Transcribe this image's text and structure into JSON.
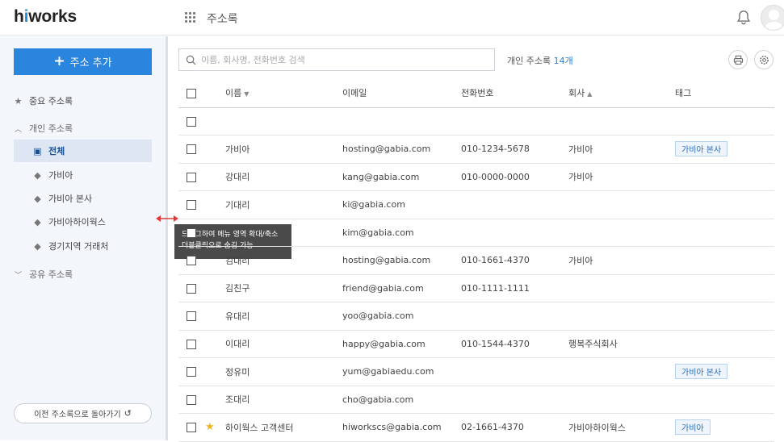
{
  "header": {
    "logo_prefix": "h",
    "logo_i": "i",
    "logo_rest": "works",
    "app_title": "주소록"
  },
  "sidebar": {
    "add_label": "주소 추가",
    "items": [
      {
        "label": "중요 주소록",
        "icon": "star-icon"
      },
      {
        "label": "개인 주소록",
        "icon": "chevron-up-icon"
      },
      {
        "label": "전체",
        "icon": "contact-card-icon",
        "selected": true
      },
      {
        "label": "가비아",
        "icon": "tag-icon"
      },
      {
        "label": "가비아 본사",
        "icon": "tag-icon"
      },
      {
        "label": "가비아하이웍스",
        "icon": "tag-icon"
      },
      {
        "label": "경기지역 거래처",
        "icon": "tag-icon"
      },
      {
        "label": "공유 주소록",
        "icon": "chevron-down-icon"
      }
    ],
    "back_label": "이전 주소록으로 돌아가기"
  },
  "tooltip": {
    "line1": "드래그하여 메뉴 영역 확대/축소",
    "line2": "더블클릭으로 숨김 가능"
  },
  "toolbar": {
    "search_placeholder": "이름, 회사명, 전화번호 검색",
    "count_label": "개인 주소록",
    "count_value": "14개"
  },
  "table": {
    "headers": {
      "name": "이름",
      "email": "이메일",
      "phone": "전화번호",
      "company": "회사",
      "tag": "태그"
    },
    "rows": [
      {
        "name": "",
        "email": "",
        "phone": "",
        "company": "",
        "tag": "",
        "star": false
      },
      {
        "name": "가비아",
        "email": "hosting@gabia.com",
        "phone": "010-1234-5678",
        "company": "가비아",
        "tag": "가비아 본사",
        "star": false
      },
      {
        "name": "강대리",
        "email": "kang@gabia.com",
        "phone": "010-0000-0000",
        "company": "가비아",
        "tag": "",
        "star": false
      },
      {
        "name": "기대리",
        "email": "ki@gabia.com",
        "phone": "",
        "company": "",
        "tag": "",
        "star": false
      },
      {
        "name": "",
        "email": "kim@gabia.com",
        "phone": "",
        "company": "",
        "tag": "",
        "star": false
      },
      {
        "name": "김대리",
        "email": "hosting@gabia.com",
        "phone": "010-1661-4370",
        "company": "가비아",
        "tag": "",
        "star": false
      },
      {
        "name": "김친구",
        "email": "friend@gabia.com",
        "phone": "010-1111-1111",
        "company": "",
        "tag": "",
        "star": false
      },
      {
        "name": "유대리",
        "email": "yoo@gabia.com",
        "phone": "",
        "company": "",
        "tag": "",
        "star": false
      },
      {
        "name": "이대리",
        "email": "happy@gabia.com",
        "phone": "010-1544-4370",
        "company": "행복주식회사",
        "tag": "",
        "star": false
      },
      {
        "name": "정유미",
        "email": "yum@gabiaedu.com",
        "phone": "",
        "company": "",
        "tag": "가비아 본사",
        "star": false
      },
      {
        "name": "조대리",
        "email": "cho@gabia.com",
        "phone": "",
        "company": "",
        "tag": "",
        "star": false
      },
      {
        "name": "하이웍스 고객센터",
        "email": "hiworkscs@gabia.com",
        "phone": "02-1661-4370",
        "company": "가비아하이웍스",
        "tag": "가비아",
        "star": true
      }
    ]
  }
}
